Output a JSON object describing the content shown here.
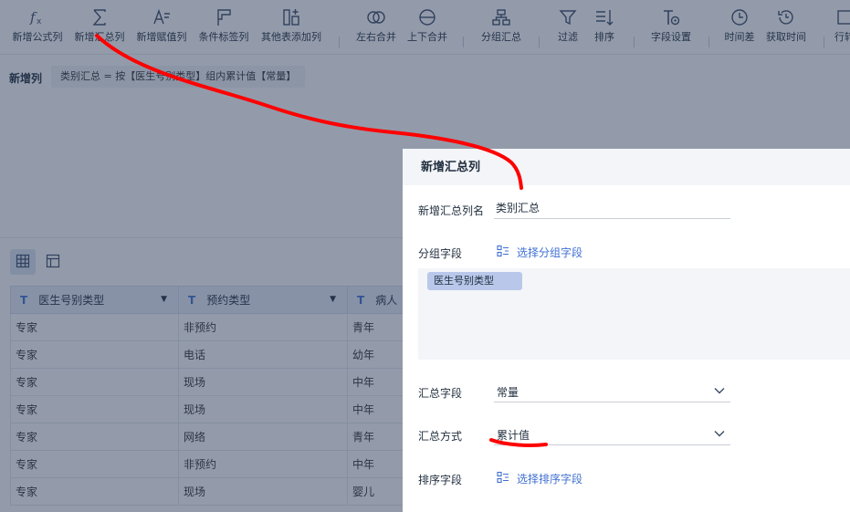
{
  "toolbar": {
    "items": [
      {
        "label": "新增公式列",
        "icon": "fx-icon"
      },
      {
        "label": "新增汇总列",
        "icon": "sigma-icon"
      },
      {
        "label": "新增赋值列",
        "icon": "assign-icon"
      },
      {
        "label": "条件标签列",
        "icon": "flag-icon"
      },
      {
        "label": "其他表添加列",
        "icon": "add-column-icon"
      },
      {
        "label": "左右合并",
        "icon": "merge-horizontal-icon"
      },
      {
        "label": "上下合并",
        "icon": "merge-vertical-icon"
      },
      {
        "label": "分组汇总",
        "icon": "group-summary-icon"
      },
      {
        "label": "过滤",
        "icon": "filter-icon"
      },
      {
        "label": "排序",
        "icon": "sort-icon"
      },
      {
        "label": "字段设置",
        "icon": "field-settings-icon"
      },
      {
        "label": "时间差",
        "icon": "clock-icon"
      },
      {
        "label": "获取时间",
        "icon": "history-clock-icon"
      },
      {
        "label": "行转",
        "icon": "row-transform-icon"
      }
    ]
  },
  "formula": {
    "label": "新增列",
    "expression": "类别汇总 = 按【医生号别类型】组内累计值【常量】"
  },
  "view": {
    "table_icon": "grid-icon",
    "layout_icon": "layout-icon"
  },
  "table": {
    "columns": [
      {
        "label": "医生号别类型",
        "icon": "T"
      },
      {
        "label": "预约类型",
        "icon": "T"
      },
      {
        "label": "病人",
        "icon": "T"
      }
    ],
    "rows": [
      [
        "专家",
        "非预约",
        "青年"
      ],
      [
        "专家",
        "电话",
        "幼年"
      ],
      [
        "专家",
        "现场",
        "中年"
      ],
      [
        "专家",
        "现场",
        "中年"
      ],
      [
        "专家",
        "网络",
        "青年"
      ],
      [
        "专家",
        "非预约",
        "中年"
      ],
      [
        "专家",
        "现场",
        "婴儿"
      ]
    ]
  },
  "dialog": {
    "title": "新增汇总列",
    "name_label": "新增汇总列名",
    "name_value": "类别汇总",
    "group_label": "分组字段",
    "group_link": "选择分组字段",
    "group_tags": [
      "医生号别类型"
    ],
    "summary_field_label": "汇总字段",
    "summary_field_value": "常量",
    "summary_method_label": "汇总方式",
    "summary_method_value": "累计值",
    "sort_label": "排序字段",
    "sort_link": "选择排序字段"
  },
  "colors": {
    "accent": "#3f6fd1",
    "overlay": "#283856",
    "annotation": "#ff0000"
  }
}
